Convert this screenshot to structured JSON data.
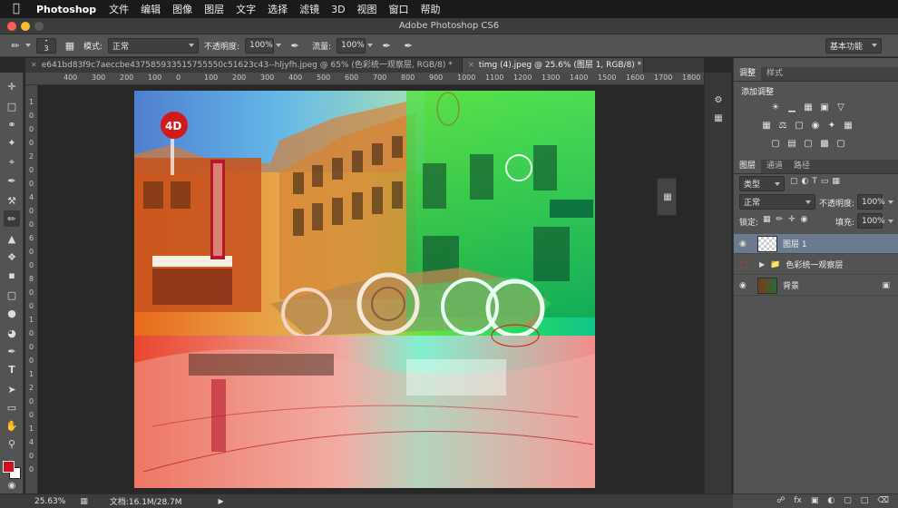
{
  "menubar": {
    "app": "Photoshop",
    "items": [
      "文件",
      "编辑",
      "图像",
      "图层",
      "文字",
      "选择",
      "滤镜",
      "3D",
      "视图",
      "窗口",
      "帮助"
    ]
  },
  "window": {
    "title": "Adobe Photoshop CS6",
    "workspace": "基本功能"
  },
  "options": {
    "brush_size": "3",
    "mode_label": "模式:",
    "mode_value": "正常",
    "opacity_label": "不透明度:",
    "opacity_value": "100%",
    "flow_label": "流量:",
    "flow_value": "100%"
  },
  "tabs": [
    {
      "label": "e641bd83f9c7aeccbe437585933515755550c51623c43--hljyfh.jpeg @ 65% (色彩统一观察层, RGB/8) *",
      "active": false
    },
    {
      "label": "timg (4).jpeg @ 25.6% (图层 1, RGB/8) *",
      "active": true
    }
  ],
  "ruler": {
    "h": [
      "400",
      "300",
      "200",
      "100",
      "0",
      "100",
      "200",
      "300",
      "400",
      "500",
      "600",
      "700",
      "800",
      "900",
      "1000",
      "1100",
      "1200",
      "1300",
      "1400",
      "1500",
      "1600",
      "1700",
      "1800",
      "1900",
      "2000"
    ],
    "v": [
      "1",
      "0",
      "0",
      "0",
      "2",
      "0",
      "0",
      "4",
      "0",
      "0",
      "6",
      "0",
      "0",
      "8",
      "0",
      "0",
      "1",
      "0",
      "0",
      "0",
      "1",
      "2",
      "0",
      "0",
      "1",
      "4",
      "0",
      "0"
    ]
  },
  "adjust_panel": {
    "tabs": [
      "调整",
      "样式"
    ],
    "title": "添加调整"
  },
  "layers_panel": {
    "tabs": [
      "图层",
      "通道",
      "路径"
    ],
    "filter_label": "类型",
    "blend_mode": "正常",
    "opacity_label": "不透明度:",
    "opacity_value": "100%",
    "lock_label": "锁定:",
    "fill_label": "填充:",
    "fill_value": "100%",
    "layers": [
      {
        "name": "图层 1",
        "selected": true
      },
      {
        "name": "色彩统一观察层",
        "group": true
      },
      {
        "name": "背景",
        "locked": true
      }
    ]
  },
  "status": {
    "zoom": "25.63%",
    "doc": "文档:16.1M/28.7M"
  },
  "colors": {
    "foreground": "#d0101c",
    "background": "#ffffff",
    "accent": "#4d6d8f"
  }
}
